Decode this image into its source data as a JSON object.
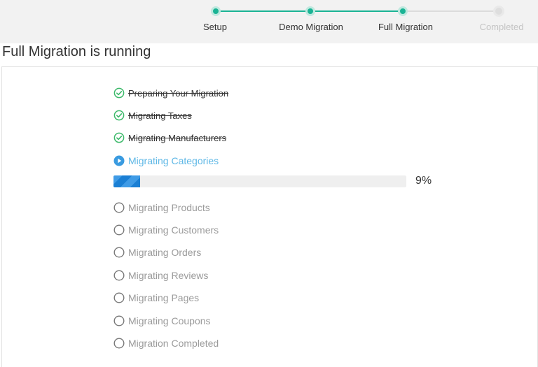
{
  "stepper": {
    "steps": [
      {
        "label": "Setup",
        "state": "done"
      },
      {
        "label": "Demo Migration",
        "state": "done"
      },
      {
        "label": "Full Migration",
        "state": "current"
      },
      {
        "label": "Completed",
        "state": "pending"
      }
    ]
  },
  "page": {
    "title": "Full Migration is running"
  },
  "tasks": [
    {
      "label": "Preparing Your Migration",
      "status": "done",
      "icon": "check-circle-icon"
    },
    {
      "label": "Migrating Taxes",
      "status": "done",
      "icon": "check-circle-icon"
    },
    {
      "label": "Migrating Manufacturers",
      "status": "done",
      "icon": "check-circle-icon"
    },
    {
      "label": "Migrating Categories",
      "status": "active",
      "icon": "play-circle-icon"
    },
    {
      "label": "Migrating Products",
      "status": "pending",
      "icon": "empty-circle-icon"
    },
    {
      "label": "Migrating Customers",
      "status": "pending",
      "icon": "empty-circle-icon"
    },
    {
      "label": "Migrating Orders",
      "status": "pending",
      "icon": "empty-circle-icon"
    },
    {
      "label": "Migrating Reviews",
      "status": "pending",
      "icon": "empty-circle-icon"
    },
    {
      "label": "Migrating Pages",
      "status": "pending",
      "icon": "empty-circle-icon"
    },
    {
      "label": "Migrating Coupons",
      "status": "pending",
      "icon": "empty-circle-icon"
    },
    {
      "label": "Migration Completed",
      "status": "pending",
      "icon": "empty-circle-icon"
    }
  ],
  "progress": {
    "percent_label": "9%",
    "value": 0.09
  },
  "colors": {
    "accent": "#1ab394",
    "active": "#5fb8e6",
    "progress": "#1a7fd4",
    "check": "#3cb96a"
  }
}
